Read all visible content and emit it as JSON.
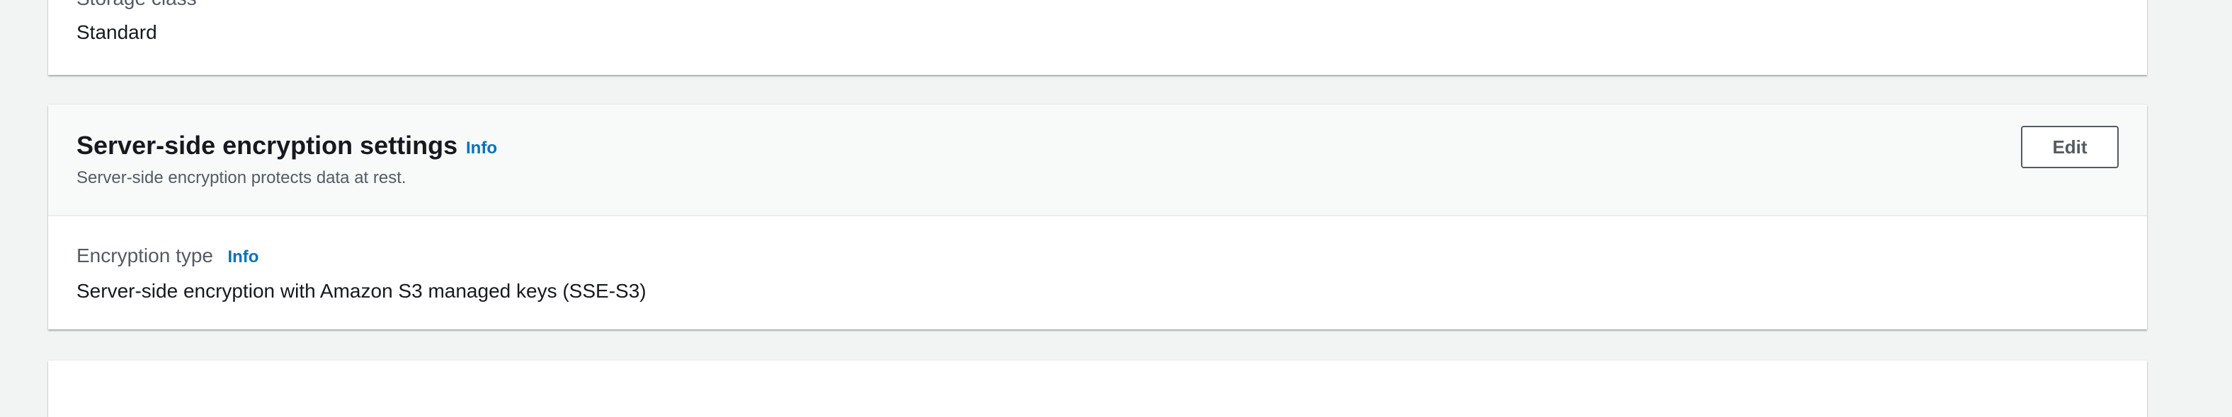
{
  "storage_panel": {
    "label": "Storage class",
    "value": "Standard"
  },
  "encryption_panel": {
    "title": "Server-side encryption settings",
    "title_info": "Info",
    "description": "Server-side encryption protects data at rest.",
    "edit_label": "Edit",
    "field_label": "Encryption type",
    "field_info": "Info",
    "field_value": "Server-side encryption with Amazon S3 managed keys (SSE-S3)"
  },
  "colors": {
    "page_background": "#f2f3f3",
    "panel_background": "#ffffff",
    "header_background": "#f8f9f9",
    "info_link": "#0073bb",
    "text_primary": "#16191f",
    "text_secondary": "#545b64"
  }
}
